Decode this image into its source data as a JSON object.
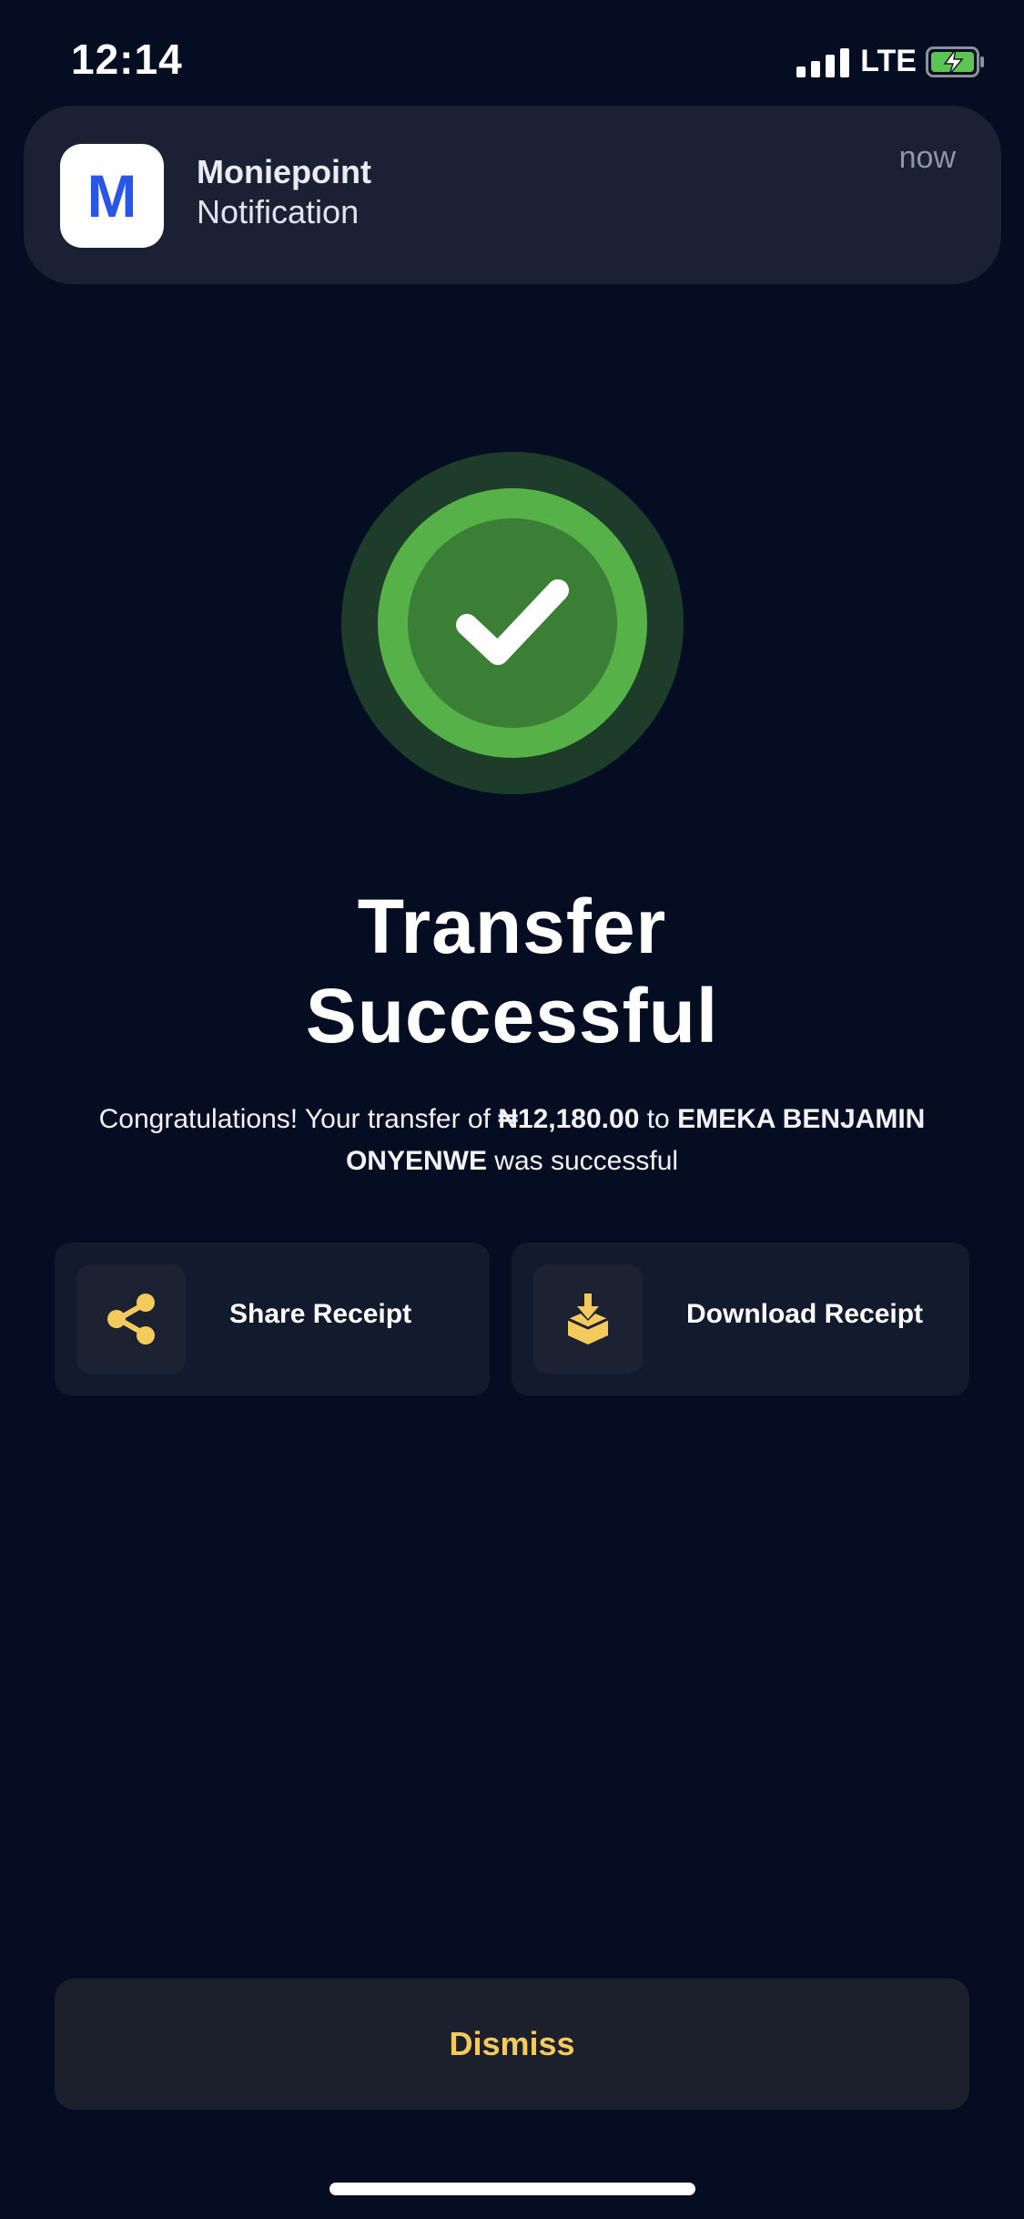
{
  "status_bar": {
    "time": "12:14",
    "network": "LTE",
    "battery_state": "charging"
  },
  "notification": {
    "app_icon_letter": "M",
    "title": "Moniepoint",
    "subtitle": "Notification",
    "time": "now"
  },
  "success": {
    "icon": "checkmark-icon",
    "title_line1": "Transfer",
    "title_line2": "Successful",
    "message": {
      "prefix": "Congratulations! Your transfer of ",
      "amount": "₦12,180.00",
      "middle": " to ",
      "recipient": "EMEKA BENJAMIN ONYENWE",
      "suffix": " was successful"
    }
  },
  "actions": {
    "share": {
      "label": "Share Receipt",
      "icon": "share-icon"
    },
    "download": {
      "label": "Download Receipt",
      "icon": "download-box-icon"
    }
  },
  "dismiss_label": "Dismiss",
  "colors": {
    "background": "#040d22",
    "card": "#121a2e",
    "accent_yellow": "#f3ca5c",
    "success_green": "#55b148",
    "success_dark_green": "#3b7f37",
    "success_halo": "#1e3c2a",
    "brand_blue": "#2a56e6"
  }
}
